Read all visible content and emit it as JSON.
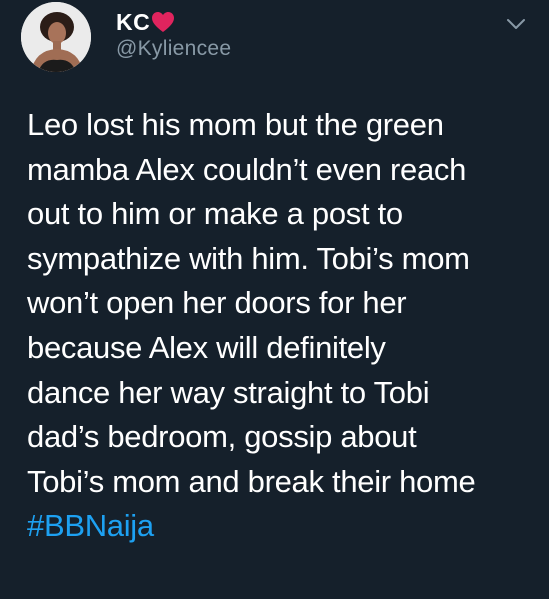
{
  "author": {
    "display_name": "KC",
    "handle": "@Kyliencee"
  },
  "tweet": {
    "lines": [
      "Leo lost his mom but the green",
      "mamba Alex couldn’t even reach",
      "out to him or make a post to",
      "sympathize with him. Tobi’s mom",
      "won’t open her doors for her",
      "because Alex will definitely",
      "dance her way straight to Tobi",
      "dad’s bedroom, gossip about",
      "Tobi’s mom and break their home"
    ],
    "hashtag": "#BBNaija"
  },
  "icons": {
    "name_emoji": "heart-icon",
    "menu": "chevron-down-icon"
  },
  "colors": {
    "background": "#15202b",
    "text": "#ffffff",
    "secondary_text": "#8899a6",
    "link": "#1da1f2",
    "heart": "#e0245e"
  }
}
